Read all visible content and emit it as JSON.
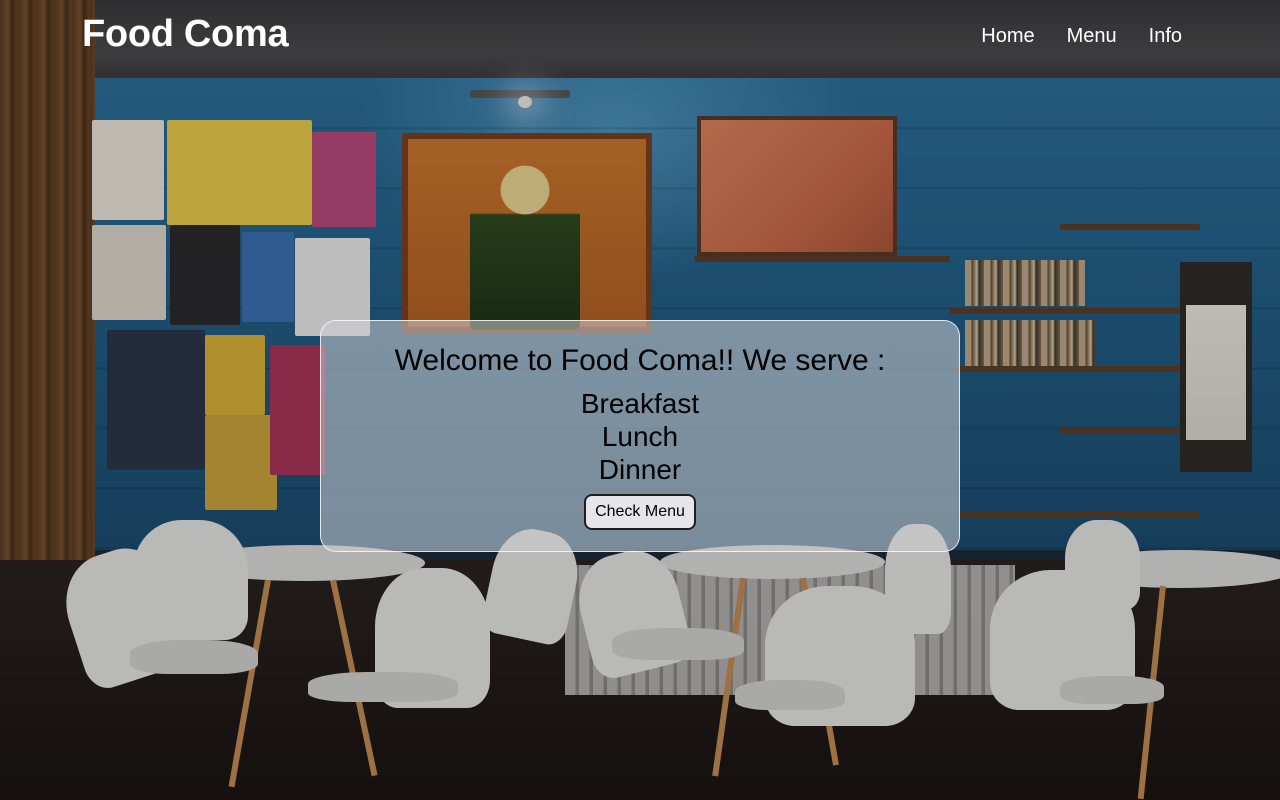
{
  "site": {
    "logo": "Food Coma"
  },
  "nav": {
    "items": [
      {
        "label": "Home"
      },
      {
        "label": "Menu"
      },
      {
        "label": "Info"
      }
    ]
  },
  "welcome": {
    "title": "Welcome to Food Coma!! We serve :",
    "meals": [
      "Breakfast",
      "Lunch",
      "Dinner"
    ],
    "button_label": "Check Menu"
  },
  "background": {
    "description_icon": "cafe-interior-photo"
  }
}
